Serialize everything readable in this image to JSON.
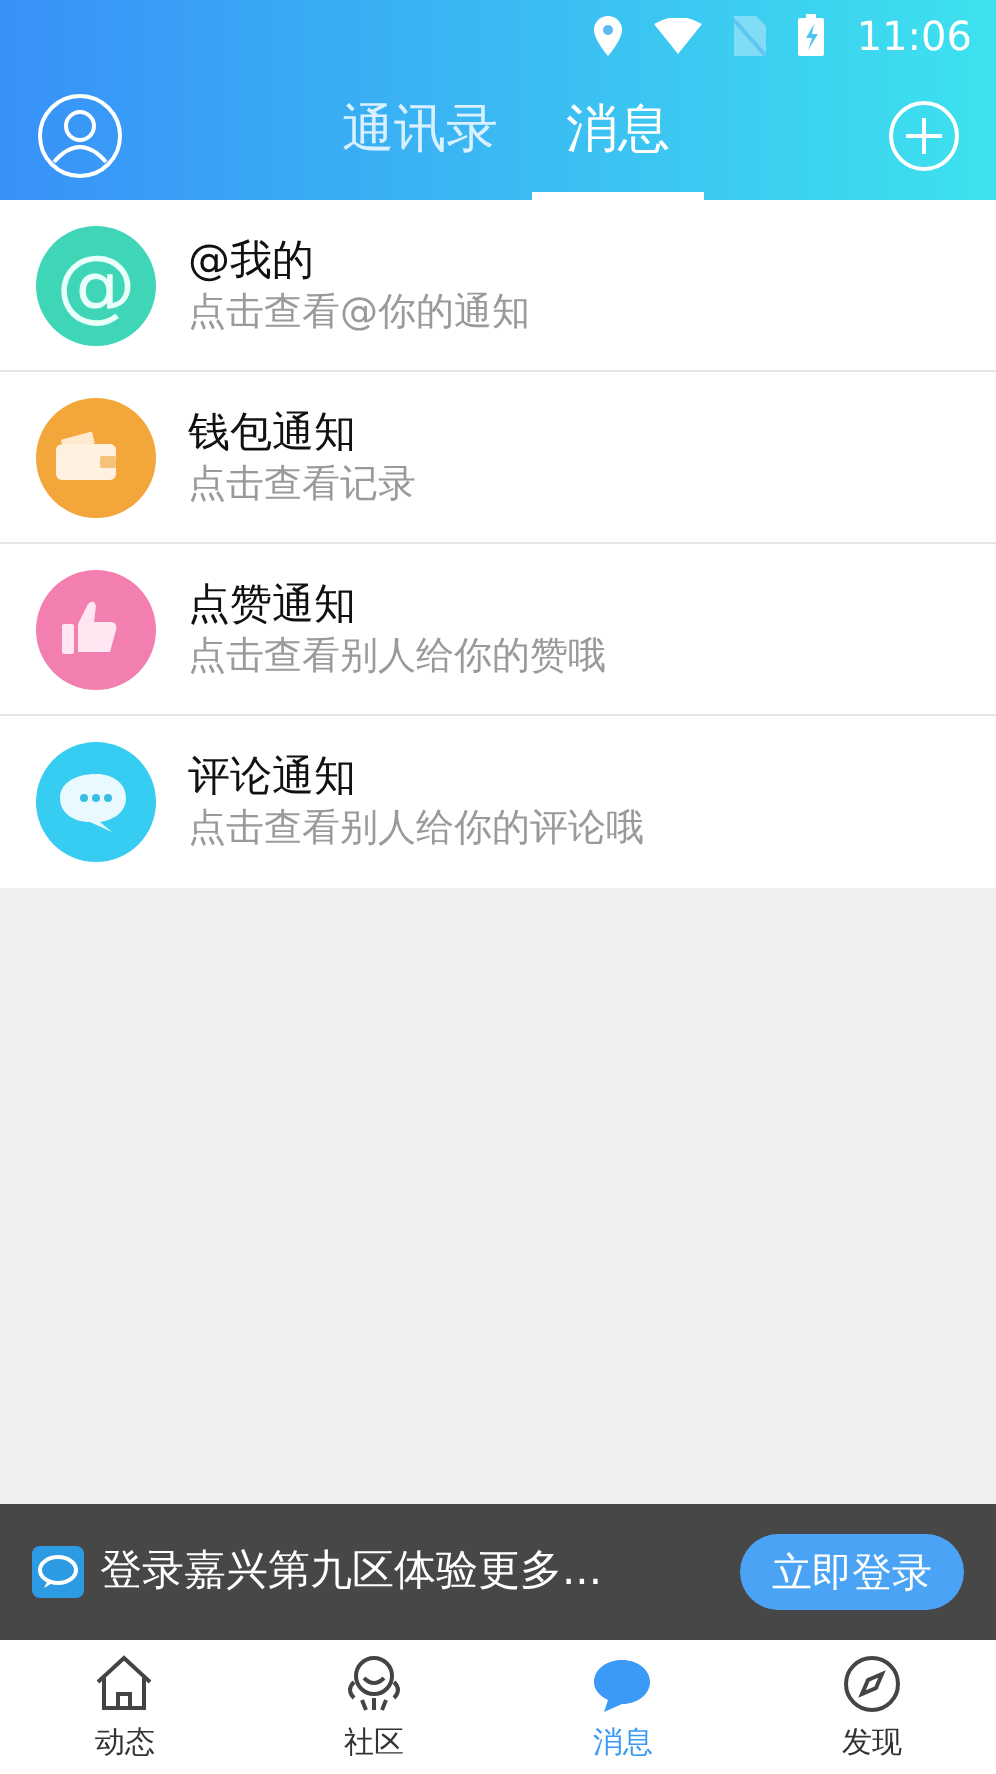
{
  "status_bar": {
    "time": "11:06"
  },
  "header": {
    "tabs": [
      {
        "label": "通讯录",
        "selected": false
      },
      {
        "label": "消息",
        "selected": true
      }
    ]
  },
  "notifications": [
    {
      "kind": "at",
      "icon_text": "@",
      "title": "@我的",
      "subtitle": "点击查看@你的通知",
      "color": "#3fd6b8"
    },
    {
      "kind": "wallet",
      "title": "钱包通知",
      "subtitle": "点击查看记录",
      "color": "#f3a63a"
    },
    {
      "kind": "like",
      "title": "点赞通知",
      "subtitle": "点击查看别人给你的赞哦",
      "color": "#f27fb0"
    },
    {
      "kind": "comment",
      "title": "评论通知",
      "subtitle": "点击查看别人给你的评论哦",
      "color": "#37cdf2"
    }
  ],
  "login_banner": {
    "text": "登录嘉兴第九区体验更多...",
    "button": "立即登录"
  },
  "bottom_nav": [
    {
      "kind": "home",
      "label": "动态",
      "selected": false
    },
    {
      "kind": "community",
      "label": "社区",
      "selected": false
    },
    {
      "kind": "message",
      "label": "消息",
      "selected": true
    },
    {
      "kind": "discover",
      "label": "发现",
      "selected": false
    }
  ]
}
